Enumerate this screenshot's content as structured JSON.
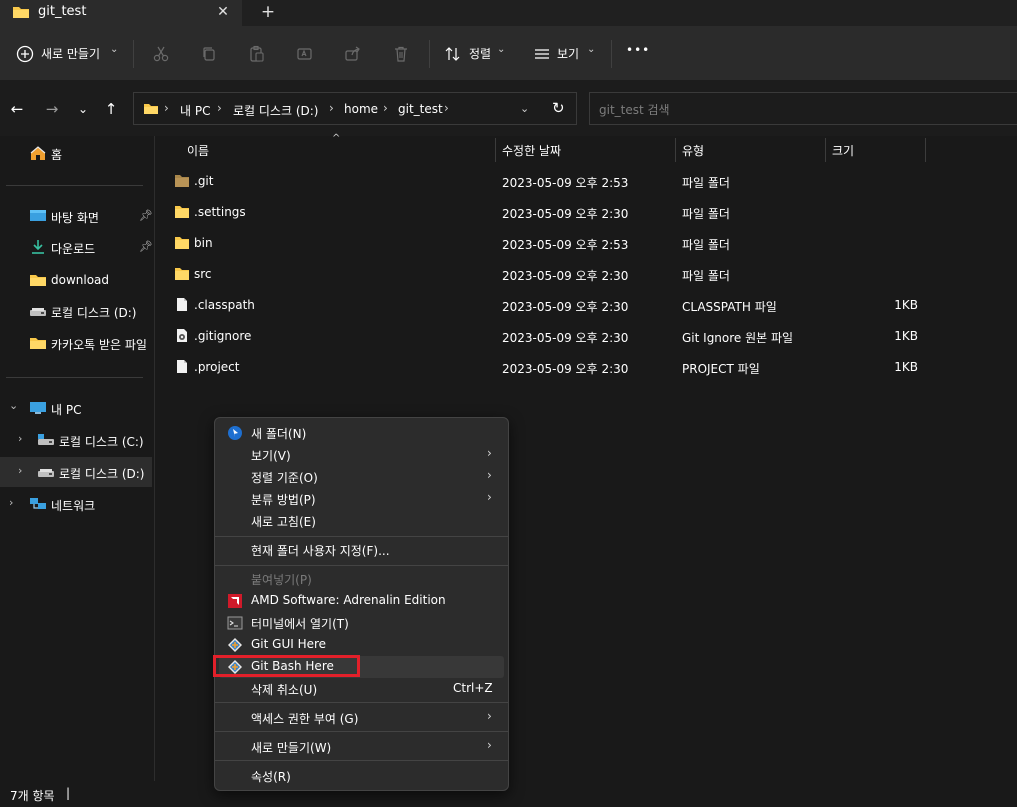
{
  "tab": {
    "title": "git_test",
    "close": "✕",
    "add": "+"
  },
  "toolbar": {
    "new_label": "새로 만들기",
    "sort_label": "정렬",
    "view_label": "보기",
    "more": "•••"
  },
  "address": {
    "crumbs": [
      "내 PC",
      "로컬 디스크 (D:)",
      "home",
      "git_test"
    ],
    "search_placeholder": "git_test 검색"
  },
  "sidebar": {
    "home": "홈",
    "items": [
      {
        "label": "바탕 화면",
        "pinned": true
      },
      {
        "label": "다운로드",
        "pinned": true
      },
      {
        "label": "download",
        "pinned": false
      },
      {
        "label": "로컬 디스크 (D:)",
        "pinned": false
      },
      {
        "label": "카카오톡 받은 파일",
        "pinned": false
      }
    ],
    "pc": "내 PC",
    "drives": [
      "로컬 디스크 (C:)",
      "로컬 디스크 (D:)"
    ],
    "network": "네트워크"
  },
  "columns": {
    "name": "이름",
    "date": "수정한 날짜",
    "type": "유형",
    "size": "크기"
  },
  "files": [
    {
      "name": ".git",
      "date": "2023-05-09 오후 2:53",
      "type": "파일 폴더",
      "size": "",
      "kind": "folder-hidden"
    },
    {
      "name": ".settings",
      "date": "2023-05-09 오후 2:30",
      "type": "파일 폴더",
      "size": "",
      "kind": "folder"
    },
    {
      "name": "bin",
      "date": "2023-05-09 오후 2:53",
      "type": "파일 폴더",
      "size": "",
      "kind": "folder"
    },
    {
      "name": "src",
      "date": "2023-05-09 오후 2:30",
      "type": "파일 폴더",
      "size": "",
      "kind": "folder"
    },
    {
      "name": ".classpath",
      "date": "2023-05-09 오후 2:30",
      "type": "CLASSPATH 파일",
      "size": "1KB",
      "kind": "file"
    },
    {
      "name": ".gitignore",
      "date": "2023-05-09 오후 2:30",
      "type": "Git Ignore 원본 파일",
      "size": "1KB",
      "kind": "gitfile"
    },
    {
      "name": ".project",
      "date": "2023-05-09 오후 2:30",
      "type": "PROJECT 파일",
      "size": "1KB",
      "kind": "file"
    }
  ],
  "context_menu": {
    "new_folder": "새 폴더(N)",
    "view": "보기(V)",
    "sort_by": "정렬 기준(O)",
    "group_by": "분류 방법(P)",
    "refresh": "새로 고침(E)",
    "customize": "현재 폴더 사용자 지정(F)...",
    "paste": "붙여넣기(P)",
    "amd": "AMD Software: Adrenalin Edition",
    "terminal": "터미널에서 열기(T)",
    "git_gui": "Git GUI Here",
    "git_bash": "Git Bash Here",
    "undo_delete": "삭제 취소(U)",
    "undo_shortcut": "Ctrl+Z",
    "give_access": "액세스 권한 부여 (G)",
    "new": "새로 만들기(W)",
    "properties": "속성(R)"
  },
  "status": {
    "count": "7개 항목",
    "sep": "|"
  },
  "colors": {
    "folder": "#f8c84a",
    "accent_highlight": "#e3202a",
    "background": "#191919"
  }
}
